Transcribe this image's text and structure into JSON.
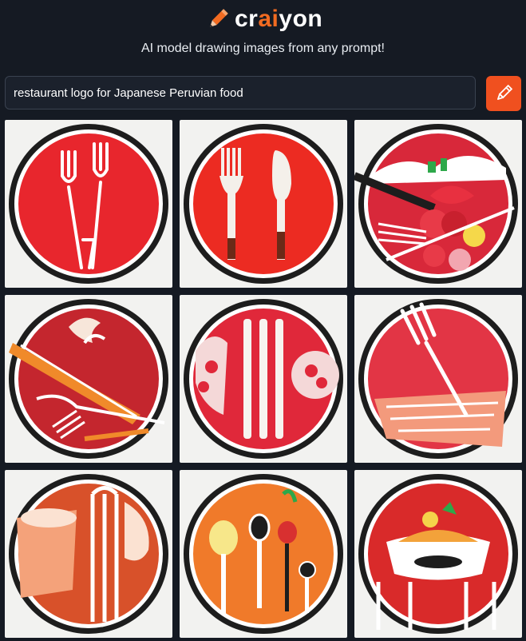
{
  "app": {
    "brand_prefix": "cr",
    "brand_accent": "ai",
    "brand_suffix": "yon",
    "subtitle": "AI model drawing images from any prompt!",
    "accent_color": "#f0501f"
  },
  "prompt": {
    "value": "restaurant logo for Japanese Peruvian food"
  },
  "draw_button": {
    "icon": "pencil-icon"
  },
  "results": {
    "images": [
      {
        "index": 1,
        "alt": "generated-image-1"
      },
      {
        "index": 2,
        "alt": "generated-image-2"
      },
      {
        "index": 3,
        "alt": "generated-image-3"
      },
      {
        "index": 4,
        "alt": "generated-image-4"
      },
      {
        "index": 5,
        "alt": "generated-image-5"
      },
      {
        "index": 6,
        "alt": "generated-image-6"
      },
      {
        "index": 7,
        "alt": "generated-image-7"
      },
      {
        "index": 8,
        "alt": "generated-image-8"
      },
      {
        "index": 9,
        "alt": "generated-image-9"
      }
    ]
  }
}
